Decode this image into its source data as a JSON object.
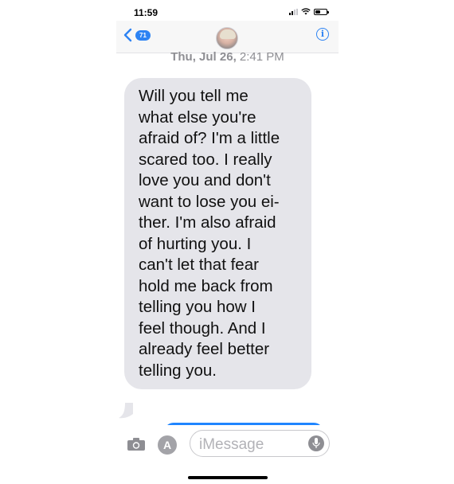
{
  "status_bar": {
    "time": "11:59"
  },
  "header": {
    "back_badge": "71",
    "info_label": "i"
  },
  "thread": {
    "date": "Thu, Jul 26,",
    "time": "2:41 PM",
    "messages": [
      {
        "direction": "received",
        "text": "Will you tell me\nwhat else you're\nafraid of? I'm a little\nscared too. I really\nlove you and don't\nwant to lose you ei-\nther. I'm also afraid\nof hurting you. I\ncan't let that fear\nhold me back from\ntelling you how I\nfeel though. And I\nalready feel better\ntelling you."
      }
    ]
  },
  "composer": {
    "placeholder": "iMessage",
    "apps_glyph": "A"
  },
  "colors": {
    "accent": "#2d83f3",
    "received_bubble": "#e5e5ea",
    "sent_bubble": "#1f85ff"
  },
  "icons": [
    "signal-icon",
    "wifi-icon",
    "battery-icon",
    "back-chevron-icon",
    "info-icon",
    "camera-icon",
    "app-store-icon",
    "microphone-icon"
  ]
}
